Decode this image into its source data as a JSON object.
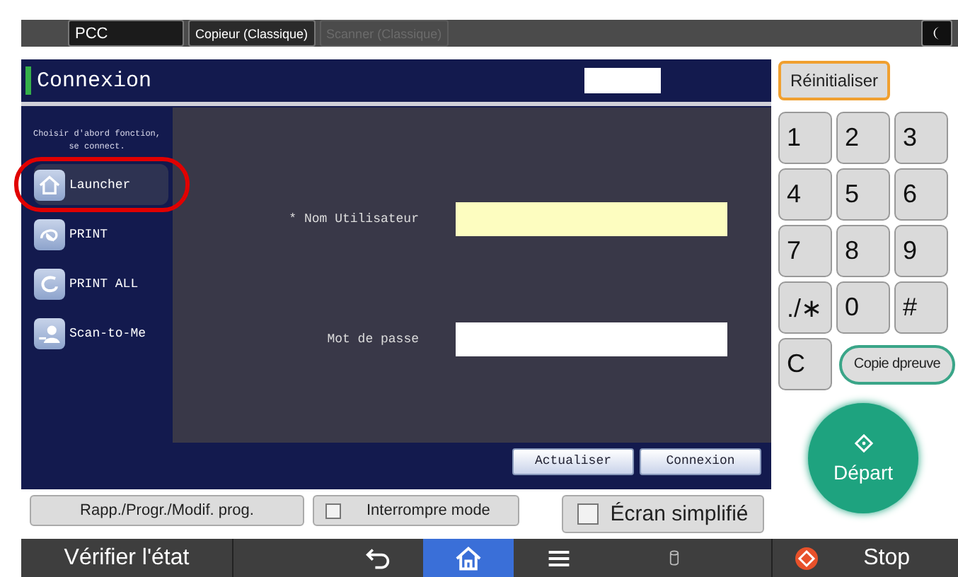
{
  "top_tabs": [
    {
      "label": "PCC",
      "selected": true,
      "disabled": false
    },
    {
      "label": "Copieur (Classique)",
      "selected": false,
      "disabled": false
    },
    {
      "label": "Scanner (Classique)",
      "selected": false,
      "disabled": true
    }
  ],
  "panel": {
    "title": "Connexion",
    "instruction": "Choisir d'abord fonction, se connect.",
    "functions": [
      {
        "label": "Launcher",
        "kind": "house",
        "highlighted": true
      },
      {
        "label": "PRINT",
        "kind": "swirl",
        "highlighted": false
      },
      {
        "label": "PRINT ALL",
        "kind": "loop",
        "highlighted": false
      },
      {
        "label": "Scan-to-Me",
        "kind": "person",
        "highlighted": false
      }
    ],
    "fields": [
      {
        "label": "* Nom Utilisateur",
        "kind": "required"
      },
      {
        "label": "Mot de passe",
        "kind": "optional"
      }
    ],
    "actions": [
      "Actualiser",
      "Connexion"
    ]
  },
  "program_button": "Rapp./Progr./Modif. prog.",
  "interrupt_mode": {
    "label": "Interrompre mode",
    "checked": false
  },
  "simple_screen": {
    "label": "Écran simplifié",
    "checked": false
  },
  "reset_button": "Réinitialiser",
  "keypad": [
    "1",
    "2",
    "3",
    "4",
    "5",
    "6",
    "7",
    "8",
    "9",
    "./∗",
    "0",
    "#",
    "C"
  ],
  "proof_copy_button": "Copie dpreuve",
  "start_button": "Départ",
  "bottom_bar": {
    "status_button": "Vérifier l'état",
    "nav": [
      {
        "kind": "back",
        "selected": false
      },
      {
        "kind": "home",
        "selected": true
      },
      {
        "kind": "menu",
        "selected": false
      }
    ],
    "stop_button": "Stop"
  }
}
